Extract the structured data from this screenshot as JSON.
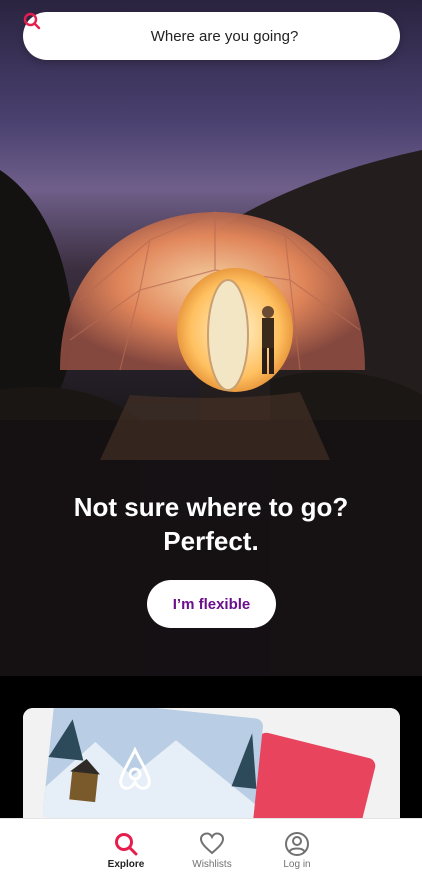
{
  "search": {
    "placeholder": "Where are you going?",
    "icon": "search-icon"
  },
  "hero": {
    "line1": "Not sure where to go?",
    "line2": "Perfect.",
    "cta_label": "I’m flexible"
  },
  "colors": {
    "brand": "#ff385c",
    "cta_text": "#6b0f8c",
    "tab_active_icon": "#e61e4d",
    "tab_inactive": "#717171"
  },
  "tabs": [
    {
      "label": "Explore",
      "icon": "search-icon",
      "active": true
    },
    {
      "label": "Wishlists",
      "icon": "heart-icon",
      "active": false
    },
    {
      "label": "Log in",
      "icon": "user-circle-icon",
      "active": false
    }
  ]
}
